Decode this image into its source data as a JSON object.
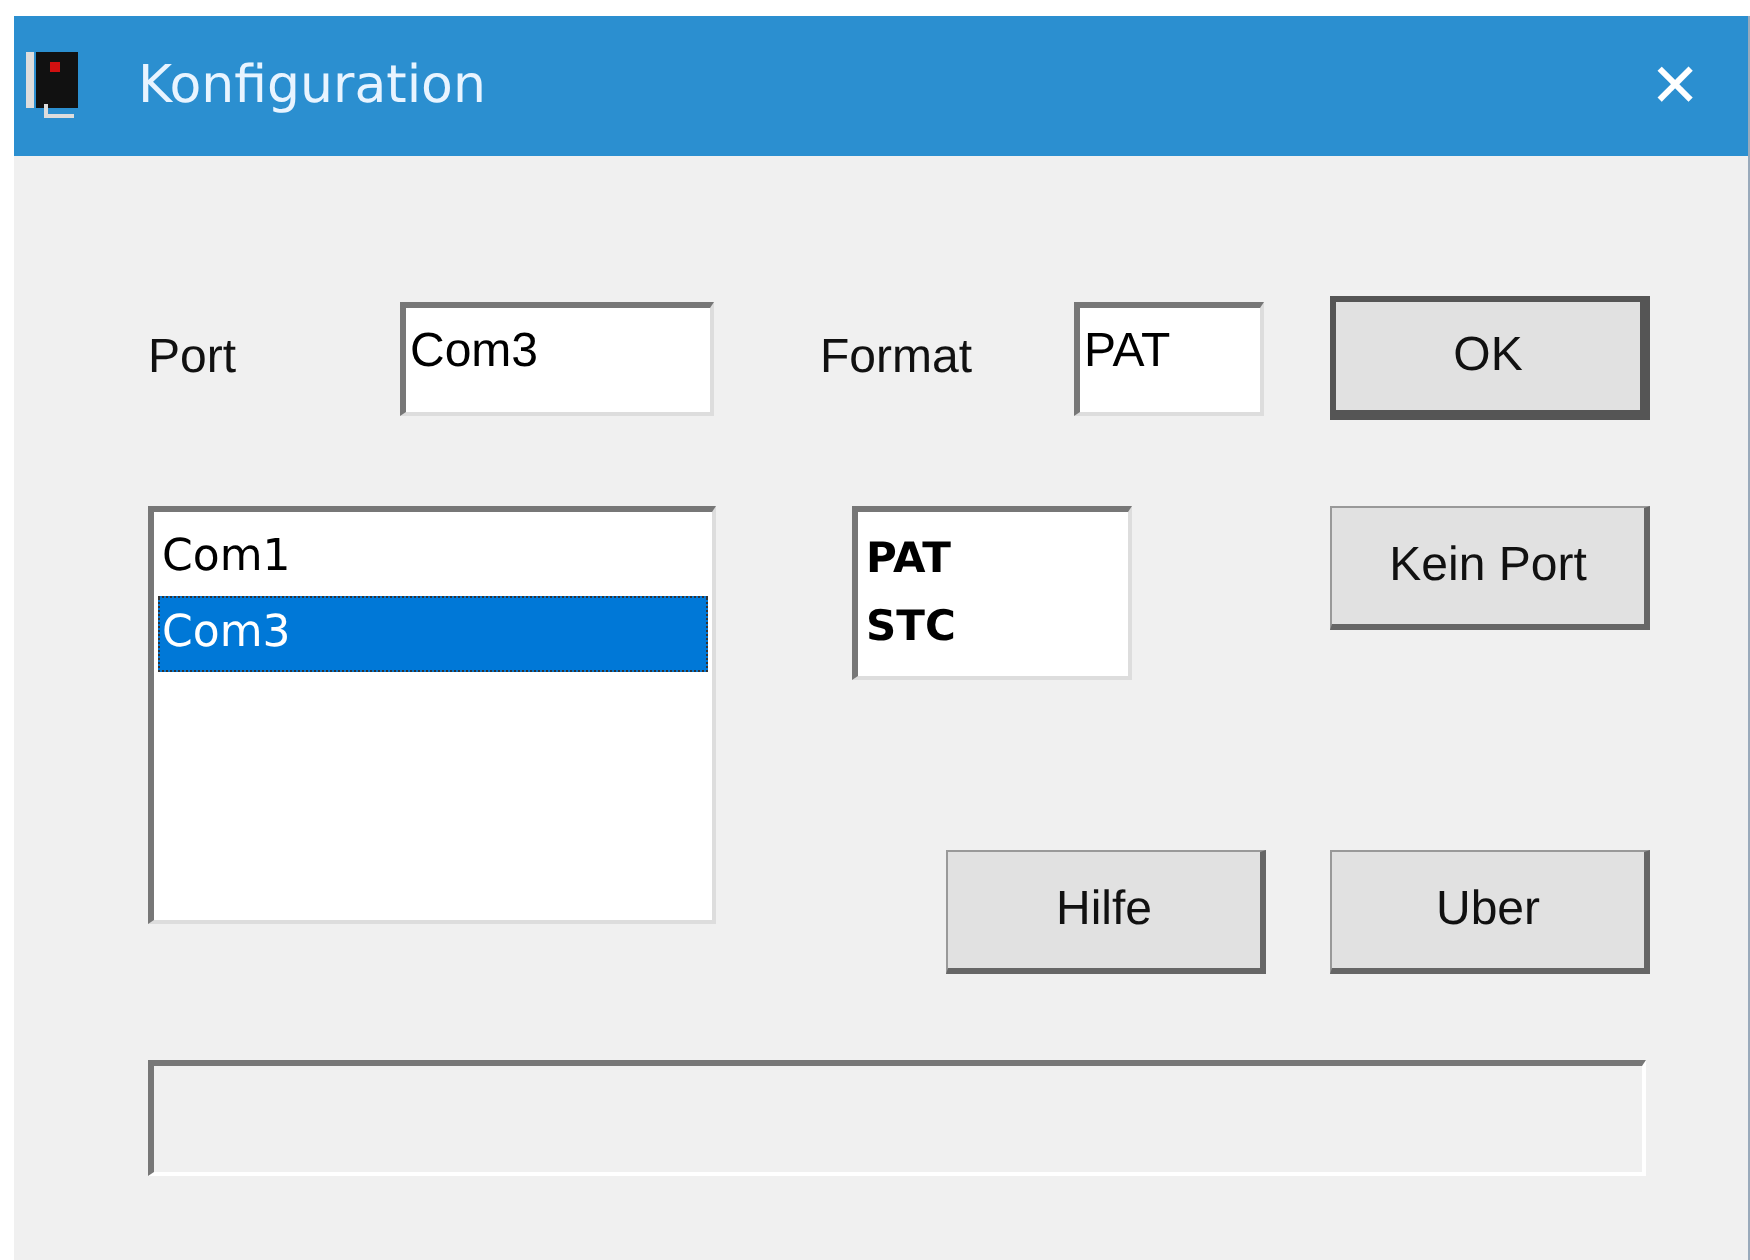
{
  "window": {
    "title": "Konfiguration",
    "close": "✕"
  },
  "port": {
    "label": "Port",
    "value": "Com3"
  },
  "format": {
    "label": "Format",
    "value": "PAT"
  },
  "port_list": [
    {
      "label": "Com1",
      "selected": false
    },
    {
      "label": "Com3",
      "selected": true
    }
  ],
  "format_list": [
    {
      "label": "PAT",
      "selected": false
    },
    {
      "label": "STC",
      "selected": false
    }
  ],
  "buttons": {
    "ok": {
      "label": "OK",
      "default": true
    },
    "no_port": {
      "label": "Kein Port",
      "default": false
    },
    "help": {
      "label": "Hilfe",
      "default": false
    },
    "about": {
      "label": "Uber",
      "default": false
    }
  }
}
